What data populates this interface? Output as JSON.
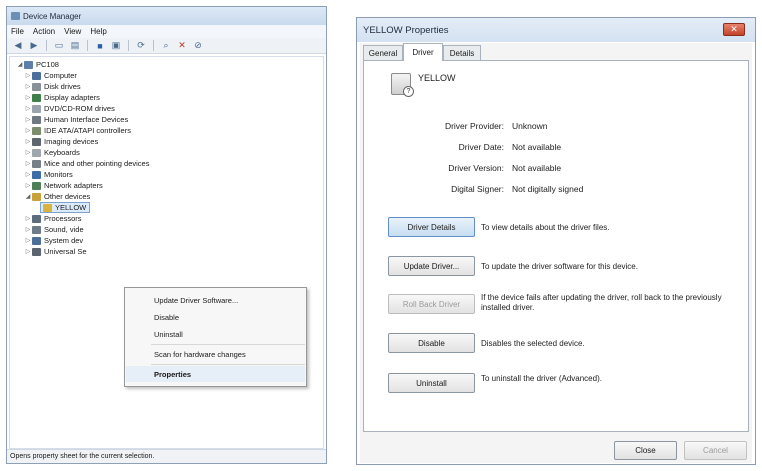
{
  "device_manager": {
    "title": "Device Manager",
    "menu": [
      "File",
      "Action",
      "View",
      "Help"
    ],
    "toolbar_icons": [
      "back-arrow-icon",
      "forward-arrow-icon",
      "up-icon",
      "show-hide-icon",
      "properties-icon",
      "help-icon",
      "update-driver-icon",
      "scan-hardware-icon",
      "uninstall-icon",
      "disable-icon"
    ],
    "tree": {
      "root": "PC108",
      "items": [
        "Computer",
        "Disk drives",
        "Display adapters",
        "DVD/CD-ROM drives",
        "Human Interface Devices",
        "IDE ATA/ATAPI controllers",
        "Imaging devices",
        "Keyboards",
        "Mice and other pointing devices",
        "Monitors",
        "Network adapters",
        "Other devices",
        "YELLOW",
        "Processors",
        "Sound, vide",
        "System dev",
        "Universal Se"
      ]
    },
    "context_menu": {
      "items": [
        "Update Driver Software...",
        "Disable",
        "Uninstall",
        "Scan for hardware changes",
        "Properties"
      ]
    },
    "status": "Opens property sheet for the current selection."
  },
  "properties": {
    "title": "YELLOW Properties",
    "close_glyph": "✕",
    "tabs": [
      "General",
      "Driver",
      "Details"
    ],
    "device_name": "YELLOW",
    "fields": [
      {
        "label": "Driver Provider:",
        "value": "Unknown"
      },
      {
        "label": "Driver Date:",
        "value": "Not available"
      },
      {
        "label": "Driver Version:",
        "value": "Not available"
      },
      {
        "label": "Digital Signer:",
        "value": "Not digitally signed"
      }
    ],
    "actions": [
      {
        "label": "Driver Details",
        "desc": "To view details about the driver files."
      },
      {
        "label": "Update Driver...",
        "desc": "To update the driver software for this device."
      },
      {
        "label": "Roll Back Driver",
        "desc": "If the device fails after updating the driver, roll back to the previously installed driver."
      },
      {
        "label": "Disable",
        "desc": "Disables the selected device."
      },
      {
        "label": "Uninstall",
        "desc": "To uninstall the driver (Advanced)."
      }
    ],
    "footer": {
      "close": "Close",
      "cancel": "Cancel"
    }
  }
}
